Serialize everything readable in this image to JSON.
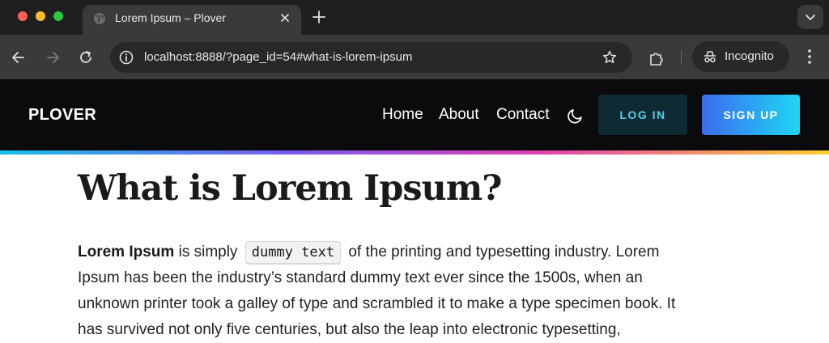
{
  "browser": {
    "tab_title": "Lorem Ipsum – Plover",
    "url": "localhost:8888/?page_id=54#what-is-lorem-ipsum",
    "profile_label": "Incognito"
  },
  "site": {
    "logo": "PLOVER",
    "nav": {
      "home": "Home",
      "about": "About",
      "contact": "Contact"
    },
    "login_label": "LOG IN",
    "signup_label": "SIGN UP"
  },
  "article": {
    "heading": "What is Lorem Ipsum?",
    "lead_bold": "Lorem Ipsum",
    "lead_text": " is simply ",
    "code": "dummy text",
    "line1_rest": " of the printing and typesetting industry. Lorem",
    "line2": "Ipsum has been the industry’s standard dummy text ever since the 1500s, when an",
    "line3": "unknown printer took a galley of type and scrambled it to make a type specimen book. It",
    "line4": "has survived not only five centuries, but also the leap into electronic typesetting,"
  }
}
